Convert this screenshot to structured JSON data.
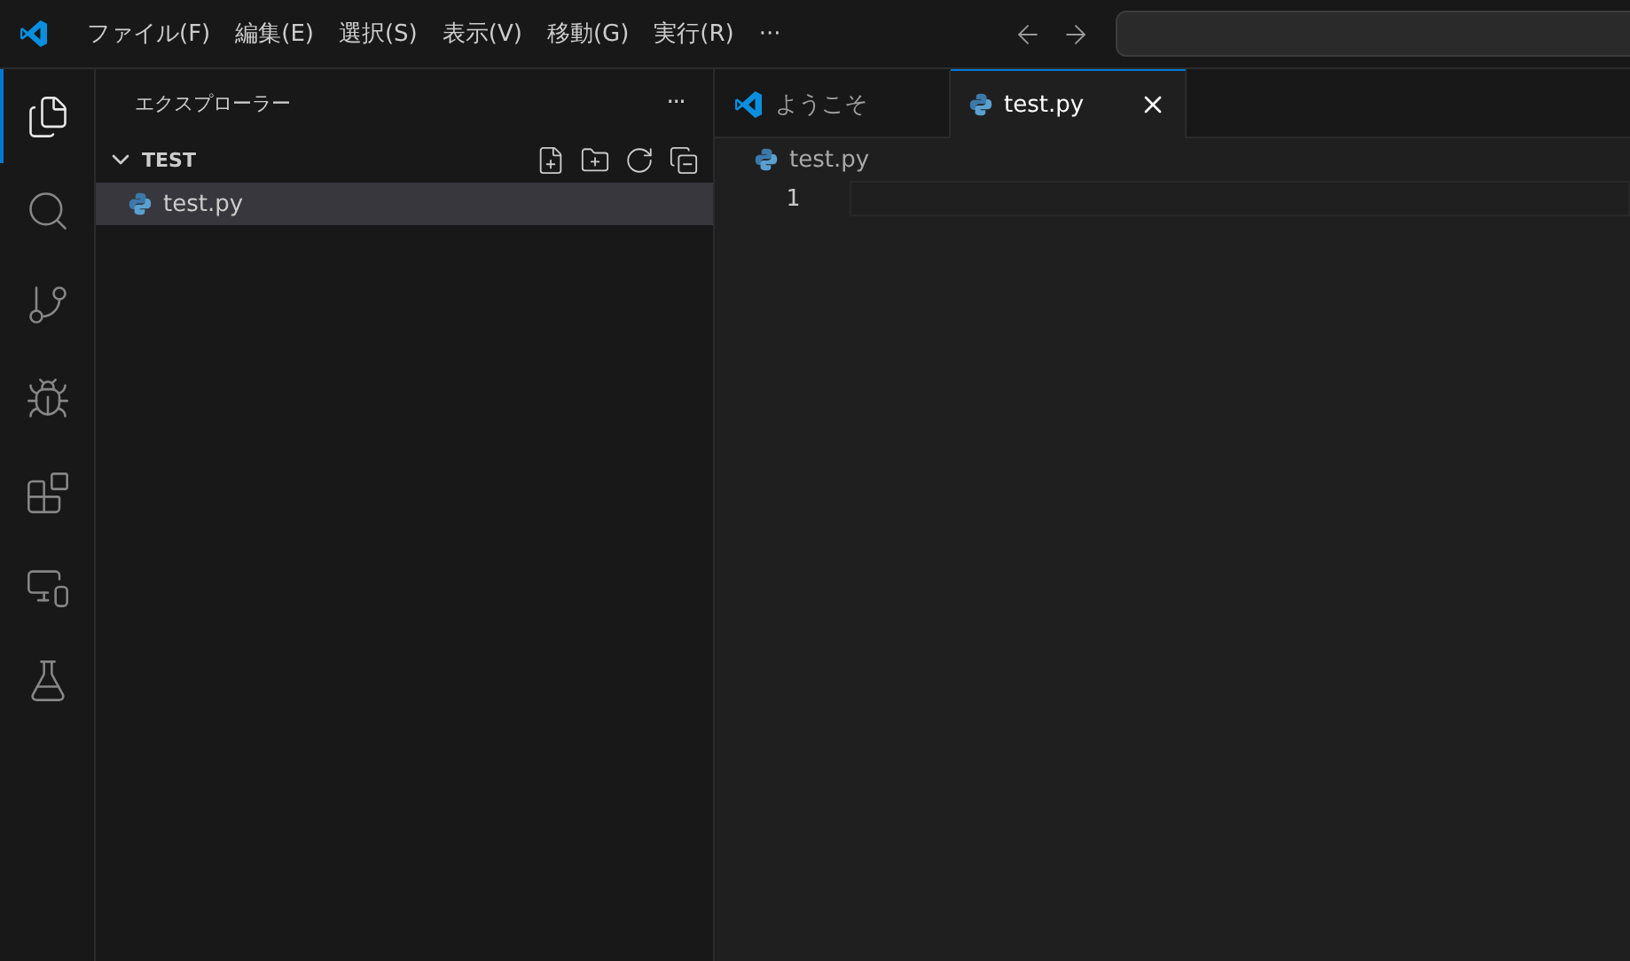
{
  "menu": {
    "items": [
      "ファイル(F)",
      "編集(E)",
      "選択(S)",
      "表示(V)",
      "移動(G)",
      "実行(R)"
    ],
    "more": "···"
  },
  "activity_bar": {
    "items": [
      {
        "kind": "explorer",
        "selected": true
      },
      {
        "kind": "search",
        "selected": false
      },
      {
        "kind": "source-control",
        "selected": false
      },
      {
        "kind": "run-debug",
        "selected": false
      },
      {
        "kind": "extensions",
        "selected": false
      },
      {
        "kind": "remote",
        "selected": false
      },
      {
        "kind": "testing",
        "selected": false
      }
    ]
  },
  "sidebar": {
    "title": "エクスプローラー",
    "more": "···",
    "folder": {
      "name": "TEST",
      "expanded": true,
      "files": [
        {
          "name": "test.py",
          "kind": "python",
          "selected": true
        }
      ]
    }
  },
  "tabs": [
    {
      "label": "ようこそ",
      "kind": "welcome",
      "selected": false
    },
    {
      "label": "test.py",
      "kind": "python",
      "selected": true
    }
  ],
  "breadcrumb": {
    "label": "test.py",
    "kind": "python"
  },
  "editor": {
    "lines": [
      {
        "number": "1",
        "current": true
      }
    ]
  }
}
